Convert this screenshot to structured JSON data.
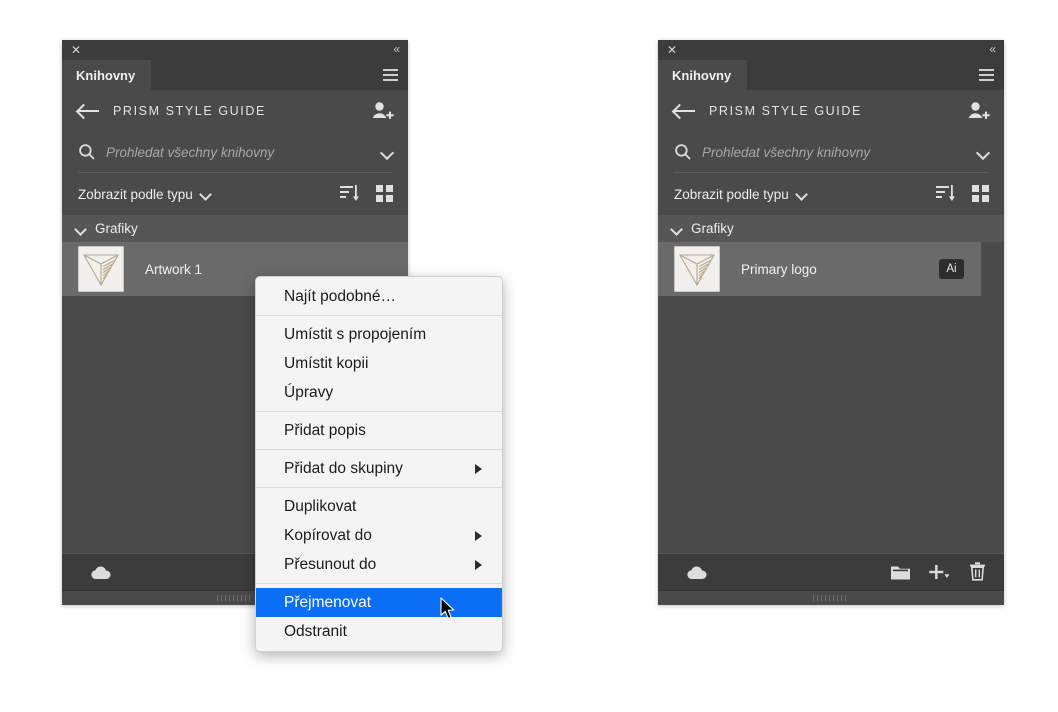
{
  "panels": [
    {
      "id": "left",
      "titlebar": {
        "close_icon": "close-icon",
        "collapse_icon": "collapse-chevrons-icon",
        "collapse_glyph": "«",
        "close_glyph": "✕"
      },
      "tab_label": "Knihovny",
      "menu_icon": "hamburger-menu-icon",
      "library": {
        "back_icon": "back-arrow-icon",
        "title": "PRISM STYLE GUIDE",
        "invite_icon": "add-collaborator-icon"
      },
      "search": {
        "icon": "search-icon",
        "value": "",
        "placeholder": "Prohledat všechny knihovny",
        "dropdown_icon": "chevron-down-icon"
      },
      "filter": {
        "label": "Zobrazit podle typu",
        "caret_icon": "chevron-down-icon",
        "sort_icon": "sort-list-icon",
        "grid_icon": "grid-view-icon"
      },
      "group": {
        "caret_icon": "chevron-down-icon",
        "label": "Grafiky"
      },
      "asset": {
        "name": "Artwork 1",
        "thumbnail_icon": "prism-logo-thumbnail",
        "badge": ""
      },
      "footer": {
        "cloud_icon": "cloud-sync-icon",
        "icons": []
      }
    },
    {
      "id": "right",
      "titlebar": {
        "close_icon": "close-icon",
        "collapse_icon": "collapse-chevrons-icon",
        "collapse_glyph": "«",
        "close_glyph": "✕"
      },
      "tab_label": "Knihovny",
      "menu_icon": "hamburger-menu-icon",
      "library": {
        "back_icon": "back-arrow-icon",
        "title": "PRISM STYLE GUIDE",
        "invite_icon": "add-collaborator-icon"
      },
      "search": {
        "icon": "search-icon",
        "value": "",
        "placeholder": "Prohledat všechny knihovny",
        "dropdown_icon": "chevron-down-icon"
      },
      "filter": {
        "label": "Zobrazit podle typu",
        "caret_icon": "chevron-down-icon",
        "sort_icon": "sort-list-icon",
        "grid_icon": "grid-view-icon"
      },
      "group": {
        "caret_icon": "chevron-down-icon",
        "label": "Grafiky"
      },
      "asset": {
        "name": "Primary logo",
        "thumbnail_icon": "prism-logo-thumbnail",
        "badge": "Ai"
      },
      "footer": {
        "cloud_icon": "cloud-sync-icon",
        "icons": [
          "new-group-folder-icon",
          "add-element-icon",
          "delete-icon"
        ]
      }
    }
  ],
  "context_menu": {
    "groups": [
      [
        {
          "label": "Najít podobné…",
          "submenu": false,
          "selected": false
        }
      ],
      [
        {
          "label": "Umístit s propojením",
          "submenu": false,
          "selected": false
        },
        {
          "label": "Umístit kopii",
          "submenu": false,
          "selected": false
        },
        {
          "label": "Úpravy",
          "submenu": false,
          "selected": false
        }
      ],
      [
        {
          "label": "Přidat popis",
          "submenu": false,
          "selected": false
        }
      ],
      [
        {
          "label": "Přidat do skupiny",
          "submenu": true,
          "selected": false
        }
      ],
      [
        {
          "label": "Duplikovat",
          "submenu": false,
          "selected": false
        },
        {
          "label": "Kopírovat  do",
          "submenu": true,
          "selected": false
        },
        {
          "label": "Přesunout  do",
          "submenu": true,
          "selected": false
        }
      ],
      [
        {
          "label": "Přejmenovat",
          "submenu": false,
          "selected": true
        },
        {
          "label": "Odstranit",
          "submenu": false,
          "selected": false
        }
      ]
    ],
    "highlight_color": "#0b6ff5"
  },
  "cursor": {
    "icon": "mouse-pointer-icon"
  },
  "colors": {
    "panel_bg": "#4a4a4a",
    "chrome_bg": "#3c3c3c",
    "group_header_bg": "#565656",
    "row_selected_bg": "#6a6a6a",
    "menu_bg": "#f4f4f4",
    "accent": "#0b6ff5",
    "text": "#ededed"
  }
}
